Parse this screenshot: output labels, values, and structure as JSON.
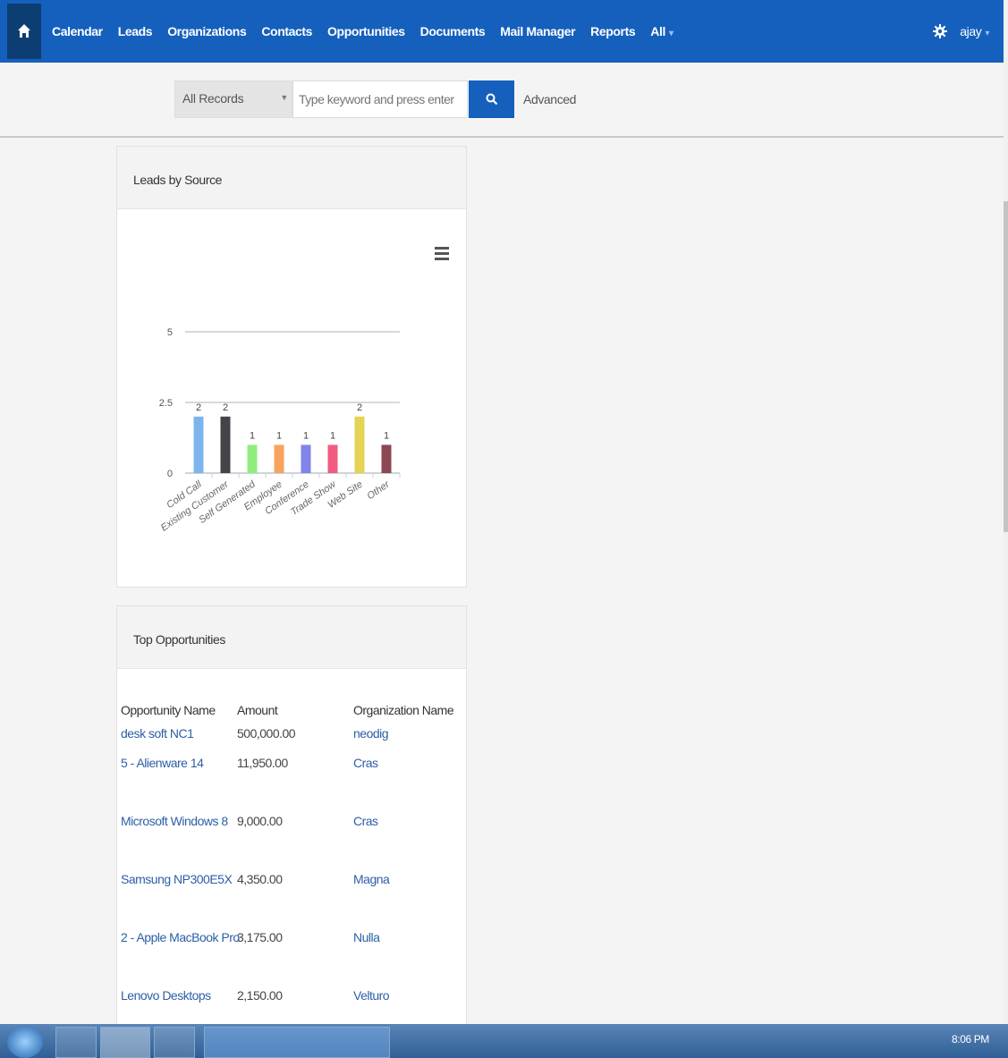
{
  "nav": {
    "items": [
      "Calendar",
      "Leads",
      "Organizations",
      "Contacts",
      "Opportunities",
      "Documents",
      "Mail Manager",
      "Reports",
      "All"
    ],
    "user": "ajay"
  },
  "search": {
    "scope": "All Records",
    "placeholder": "Type keyword and press enter",
    "advanced": "Advanced"
  },
  "leads_widget": {
    "title": "Leads by Source"
  },
  "chart_data": {
    "type": "bar",
    "categories": [
      "Cold Call",
      "Existing Customer",
      "Self Generated",
      "Employee",
      "Conference",
      "Trade Show",
      "Web Site",
      "Other"
    ],
    "values": [
      2,
      2,
      1,
      1,
      1,
      1,
      2,
      1
    ],
    "colors": [
      "#7cb5ec",
      "#434348",
      "#90ed7d",
      "#f7a35c",
      "#8085e9",
      "#f15c80",
      "#e4d354",
      "#8d4653"
    ],
    "yticks": [
      "0",
      "2.5",
      "5"
    ],
    "ylim": [
      0,
      5
    ],
    "grid": true,
    "data_labels": true
  },
  "top_widget": {
    "title": "Top Opportunities",
    "columns": [
      "Opportunity Name",
      "Amount",
      "Organization Name"
    ],
    "rows": [
      [
        "desk soft NC1",
        "500,000.00",
        "neodig"
      ],
      [
        "5 - Alienware 14",
        "11,950.00",
        "Cras"
      ],
      [
        "Microsoft Windows 8",
        "9,000.00",
        "Cras"
      ],
      [
        "Samsung NP300E5X",
        "4,350.00",
        "Magna"
      ],
      [
        "2 - Apple MacBook Pro",
        "3,175.00",
        "Nulla"
      ],
      [
        "Lenovo Desktops",
        "2,150.00",
        "Velturo"
      ]
    ]
  },
  "taskbar": {
    "clock": "8:06 PM"
  },
  "icons": {
    "home": "home-icon",
    "settings": "gear-icon",
    "search": "search-icon",
    "chart_menu": "hamburger-menu-icon"
  },
  "colors": {
    "nav_bg": "#1560bd",
    "home_bg": "#0c3d73",
    "link": "#2d5fa6"
  }
}
